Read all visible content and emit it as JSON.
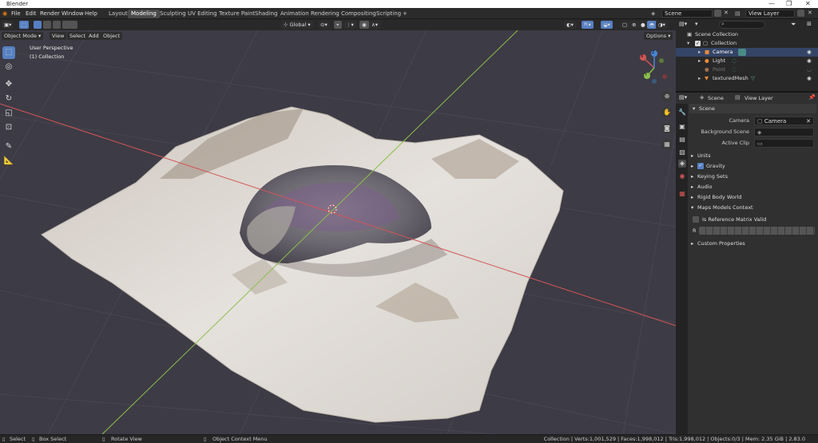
{
  "app_title": "Blender",
  "window_controls": [
    "—",
    "❐",
    "✕"
  ],
  "menu": [
    "File",
    "Edit",
    "Render",
    "Window",
    "Help"
  ],
  "workspaces": [
    "Layout",
    "Modeling",
    "Sculpting",
    "UV Editing",
    "Texture Paint",
    "Shading",
    "Animation",
    "Rendering",
    "Compositing",
    "Scripting"
  ],
  "active_workspace": "Modeling",
  "add_workspace": "+",
  "scene_field": "Scene",
  "view_layer_field": "View Layer",
  "viewport_header": {
    "mode": "Object Mode",
    "view": "View",
    "select": "Select",
    "add": "Add",
    "object": "Object",
    "transform_orientation": "Global",
    "options": "Options"
  },
  "viewport_overlay": {
    "perspective": "User Perspective",
    "collection": "(1) Collection"
  },
  "gizmo_axes": {
    "x": "X",
    "y": "Y",
    "z": "Z"
  },
  "outliner": {
    "search_placeholder": "",
    "root": "Scene Collection",
    "items": [
      {
        "label": "Collection"
      },
      {
        "label": "Camera"
      },
      {
        "label": "Light"
      },
      {
        "label": "Point"
      },
      {
        "label": "texturedMesh"
      }
    ]
  },
  "properties": {
    "tab_scene": "Scene",
    "tab_view_layer": "View Layer",
    "section_scene": "Scene",
    "camera_label": "Camera",
    "camera_value": "Camera",
    "background_scene_label": "Background Scene",
    "active_clip_label": "Active Clip",
    "units": "Units",
    "gravity": "Gravity",
    "gravity_checked": true,
    "keying_sets": "Keying Sets",
    "audio": "Audio",
    "rigid_body_world": "Rigid Body World",
    "maps_models_context": "Maps Models Context",
    "is_reference_matrix_valid": "Is Reference Matrix Valid",
    "r_label": "R",
    "custom_properties": "Custom Properties"
  },
  "status": {
    "select": "Select",
    "box_select": "Box Select",
    "rotate_view": "Rotate View",
    "context_menu": "Object Context Menu",
    "stats": "Collection | Verts:1,001,529 | Faces:1,998,012 | Tris:1,998,012 | Objects:0/3 | Mem: 2.35 GiB | 2.83.0"
  },
  "colors": {
    "accent": "#5680c2",
    "x_axis": "#d45656",
    "y_axis": "#8cc04a",
    "z_axis": "#4a86d4",
    "viewport_bg": "#3d3b45"
  }
}
